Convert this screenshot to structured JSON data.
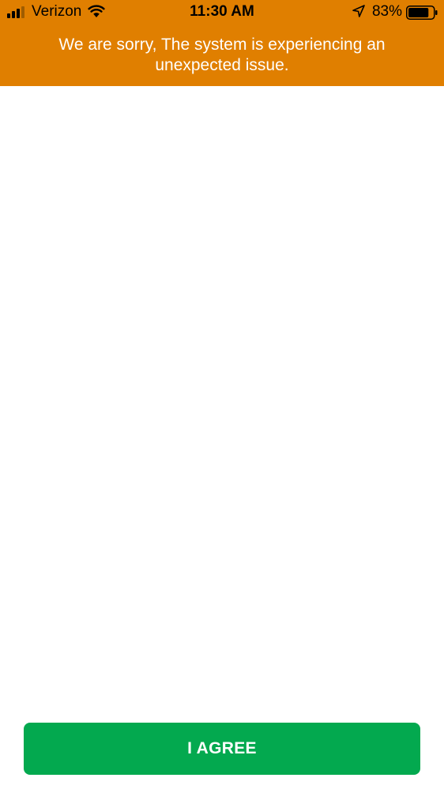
{
  "status_bar": {
    "carrier": "Verizon",
    "time": "11:30 AM",
    "battery_percent": "83%",
    "signal_icon": "signal-bars-icon",
    "wifi_icon": "wifi-icon",
    "location_icon": "location-arrow-icon",
    "battery_icon": "battery-icon",
    "battery_level": 0.83
  },
  "banner": {
    "message": "We are sorry, The system is experiencing an unexpected issue.",
    "background_color": "#e07f00"
  },
  "footer": {
    "agree_label": "I AGREE",
    "button_color": "#03a94f"
  }
}
